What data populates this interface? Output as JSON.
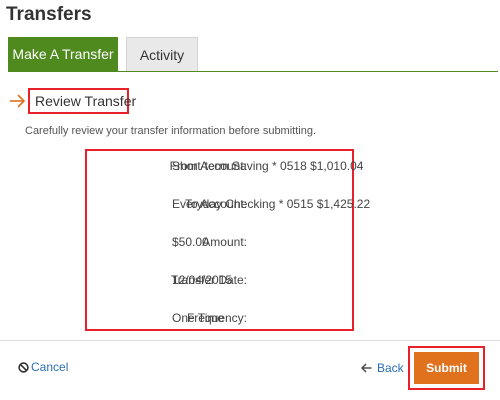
{
  "page": {
    "title": "Transfers"
  },
  "tabs": [
    {
      "label": "Make A Transfer",
      "active": true
    },
    {
      "label": "Activity",
      "active": false
    }
  ],
  "review": {
    "title": "Review Transfer",
    "instructions": "Carefully review your transfer information before submitting.",
    "icon": "arrow-right-icon"
  },
  "details": [
    {
      "label": "From Account:",
      "value": "Short-term Saving * 0518 $1,010.04"
    },
    {
      "label": "To Account:",
      "value": "Everyday Checking * 0515 $1,425.22"
    },
    {
      "label": "Amount:",
      "value": "$50.00"
    },
    {
      "label": "Transfer Date:",
      "value": "12/04/2015"
    },
    {
      "label": "Frequency:",
      "value": "One Time"
    }
  ],
  "actions": {
    "cancel_label": "Cancel",
    "cancel_icon": "cancel-circle-icon",
    "back_label": "Back",
    "back_icon": "arrow-left-icon",
    "submit_label": "Submit"
  },
  "colors": {
    "tab_active": "#4f8a1e",
    "highlight_outline": "#e8202a",
    "submit": "#e0711d",
    "link": "#2a6fb5",
    "arrow": "#e0711d"
  }
}
